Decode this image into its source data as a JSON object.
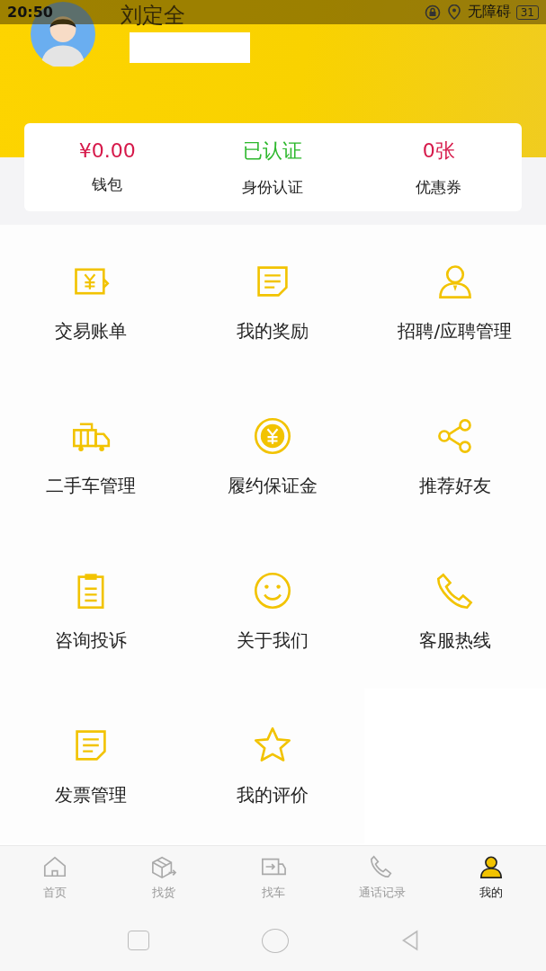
{
  "status_bar": {
    "time": "20:50",
    "accessibility": "无障碍",
    "battery": "31"
  },
  "profile": {
    "name": "刘定全"
  },
  "summary": [
    {
      "value": "¥0.00",
      "label": "钱包",
      "color": "#d6194a"
    },
    {
      "value": "已认证",
      "label": "身份认证",
      "color": "#2db82d"
    },
    {
      "value": "0张",
      "label": "优惠券",
      "color": "#d6194a"
    }
  ],
  "menu": [
    {
      "label": "交易账单",
      "kind": "bill"
    },
    {
      "label": "我的奖励",
      "kind": "note"
    },
    {
      "label": "招聘/应聘管理",
      "kind": "person"
    },
    {
      "label": "二手车管理",
      "kind": "truck"
    },
    {
      "label": "履约保证金",
      "kind": "coin"
    },
    {
      "label": "推荐好友",
      "kind": "share"
    },
    {
      "label": "咨询投诉",
      "kind": "clipboard"
    },
    {
      "label": "关于我们",
      "kind": "smile"
    },
    {
      "label": "客服热线",
      "kind": "phone"
    },
    {
      "label": "发票管理",
      "kind": "note"
    },
    {
      "label": "我的评价",
      "kind": "star"
    }
  ],
  "tab_bar": [
    {
      "label": "首页",
      "kind": "home",
      "selected": false
    },
    {
      "label": "找货",
      "kind": "box",
      "selected": false
    },
    {
      "label": "找车",
      "kind": "van",
      "selected": false
    },
    {
      "label": "通话记录",
      "kind": "phone",
      "selected": false
    },
    {
      "label": "我的",
      "kind": "user",
      "selected": true
    }
  ]
}
